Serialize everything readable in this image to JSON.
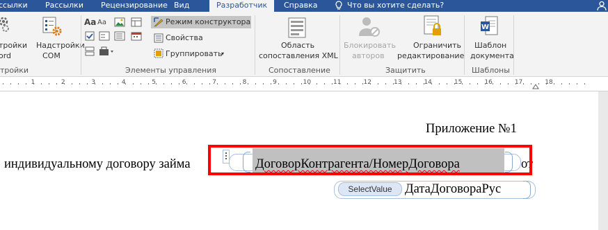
{
  "tabs": [
    {
      "label": "ссылки"
    },
    {
      "label": "Рассылки"
    },
    {
      "label": "Рецензирование"
    },
    {
      "label": "Вид"
    },
    {
      "label": "Разработчик"
    },
    {
      "label": "Справка"
    }
  ],
  "tell_me": "Что вы хотите сделать?",
  "ribbon": {
    "word_settings_label": [
      "тройки",
      "ord"
    ],
    "com_addins_label": [
      "Надстройки",
      "COM"
    ],
    "addins_group": "тройки",
    "design_mode": "Режим конструктора",
    "properties": "Свойства",
    "group": "Группировать",
    "controls_group": "Элементы управления",
    "xml_pane_label": [
      "Область",
      "сопоставления XML"
    ],
    "mapping_group": "Сопоставление",
    "block_authors_label": [
      "Блокировать",
      "авторов"
    ],
    "restrict_label": [
      "Ограничить",
      "редактирование"
    ],
    "protect_group": "Защитить",
    "template_label": [
      "Шаблон",
      "документа"
    ],
    "templates_group": "Шаблоны"
  },
  "ruler": {
    "numbers": [
      "1",
      "2",
      "3",
      "4",
      "5",
      "6",
      "7",
      "8",
      "9",
      "10",
      "11",
      "12",
      "13",
      "14",
      "15",
      "16",
      "17",
      "18"
    ]
  },
  "document": {
    "heading": "Приложение №1",
    "line1_prefix": "индивидуальному договору займа",
    "cc_number": "ДоговорКонтрагента/НомерДоговора",
    "line1_suffix": "от",
    "cc_tag": "SelectValue",
    "cc_date": "ДатаДоговораРус"
  },
  "colors": {
    "accent": "#2b579a",
    "highlight_box": "#ff0000",
    "cc_selected": "#c0c0c0"
  }
}
